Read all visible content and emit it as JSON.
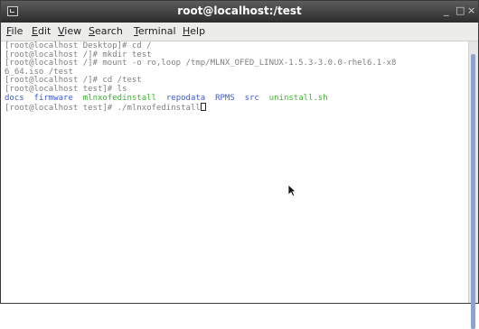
{
  "window": {
    "title": "root@localhost:/test",
    "minimize_glyph": "_",
    "maximize_glyph": "□",
    "close_glyph": "×"
  },
  "menubar": {
    "items": [
      {
        "first": "F",
        "rest": "ile"
      },
      {
        "first": "E",
        "rest": "dit"
      },
      {
        "first": "V",
        "rest": "iew"
      },
      {
        "first": "S",
        "rest": "earch"
      },
      {
        "first": "T",
        "rest": "erminal"
      },
      {
        "first": "H",
        "rest": "elp"
      }
    ]
  },
  "terminal": {
    "lines": [
      "[root@localhost Desktop]# cd /",
      "[root@localhost /]# mkdir test",
      "[root@localhost /]# mount -o ro,loop /tmp/MLNX_OFED_LINUX-1.5.3-3.0.0-rhel6.1-x8",
      "6_64.iso /test",
      "[root@localhost /]# cd /test",
      "[root@localhost test]# ls"
    ],
    "ls_output": [
      {
        "text": "docs",
        "color": "#3c5adc"
      },
      {
        "text": "firmware",
        "color": "#3c5adc"
      },
      {
        "text": "mlnxofedinstall",
        "color": "#38b82c"
      },
      {
        "text": "repodata",
        "color": "#3c5adc"
      },
      {
        "text": "RPMS",
        "color": "#3c5adc"
      },
      {
        "text": "src",
        "color": "#3c5adc"
      },
      {
        "text": "uninstall.sh",
        "color": "#38b82c"
      }
    ],
    "prompt_line": "[root@localhost test]# ./mlnxofedinstall"
  },
  "colors": {
    "titlebar": "#3a3a3a",
    "menubar": "#ececea",
    "prompt_text": "#808080",
    "directory": "#3c5adc",
    "executable": "#38b82c",
    "scrollbar_thumb": "#8aa4d8"
  }
}
